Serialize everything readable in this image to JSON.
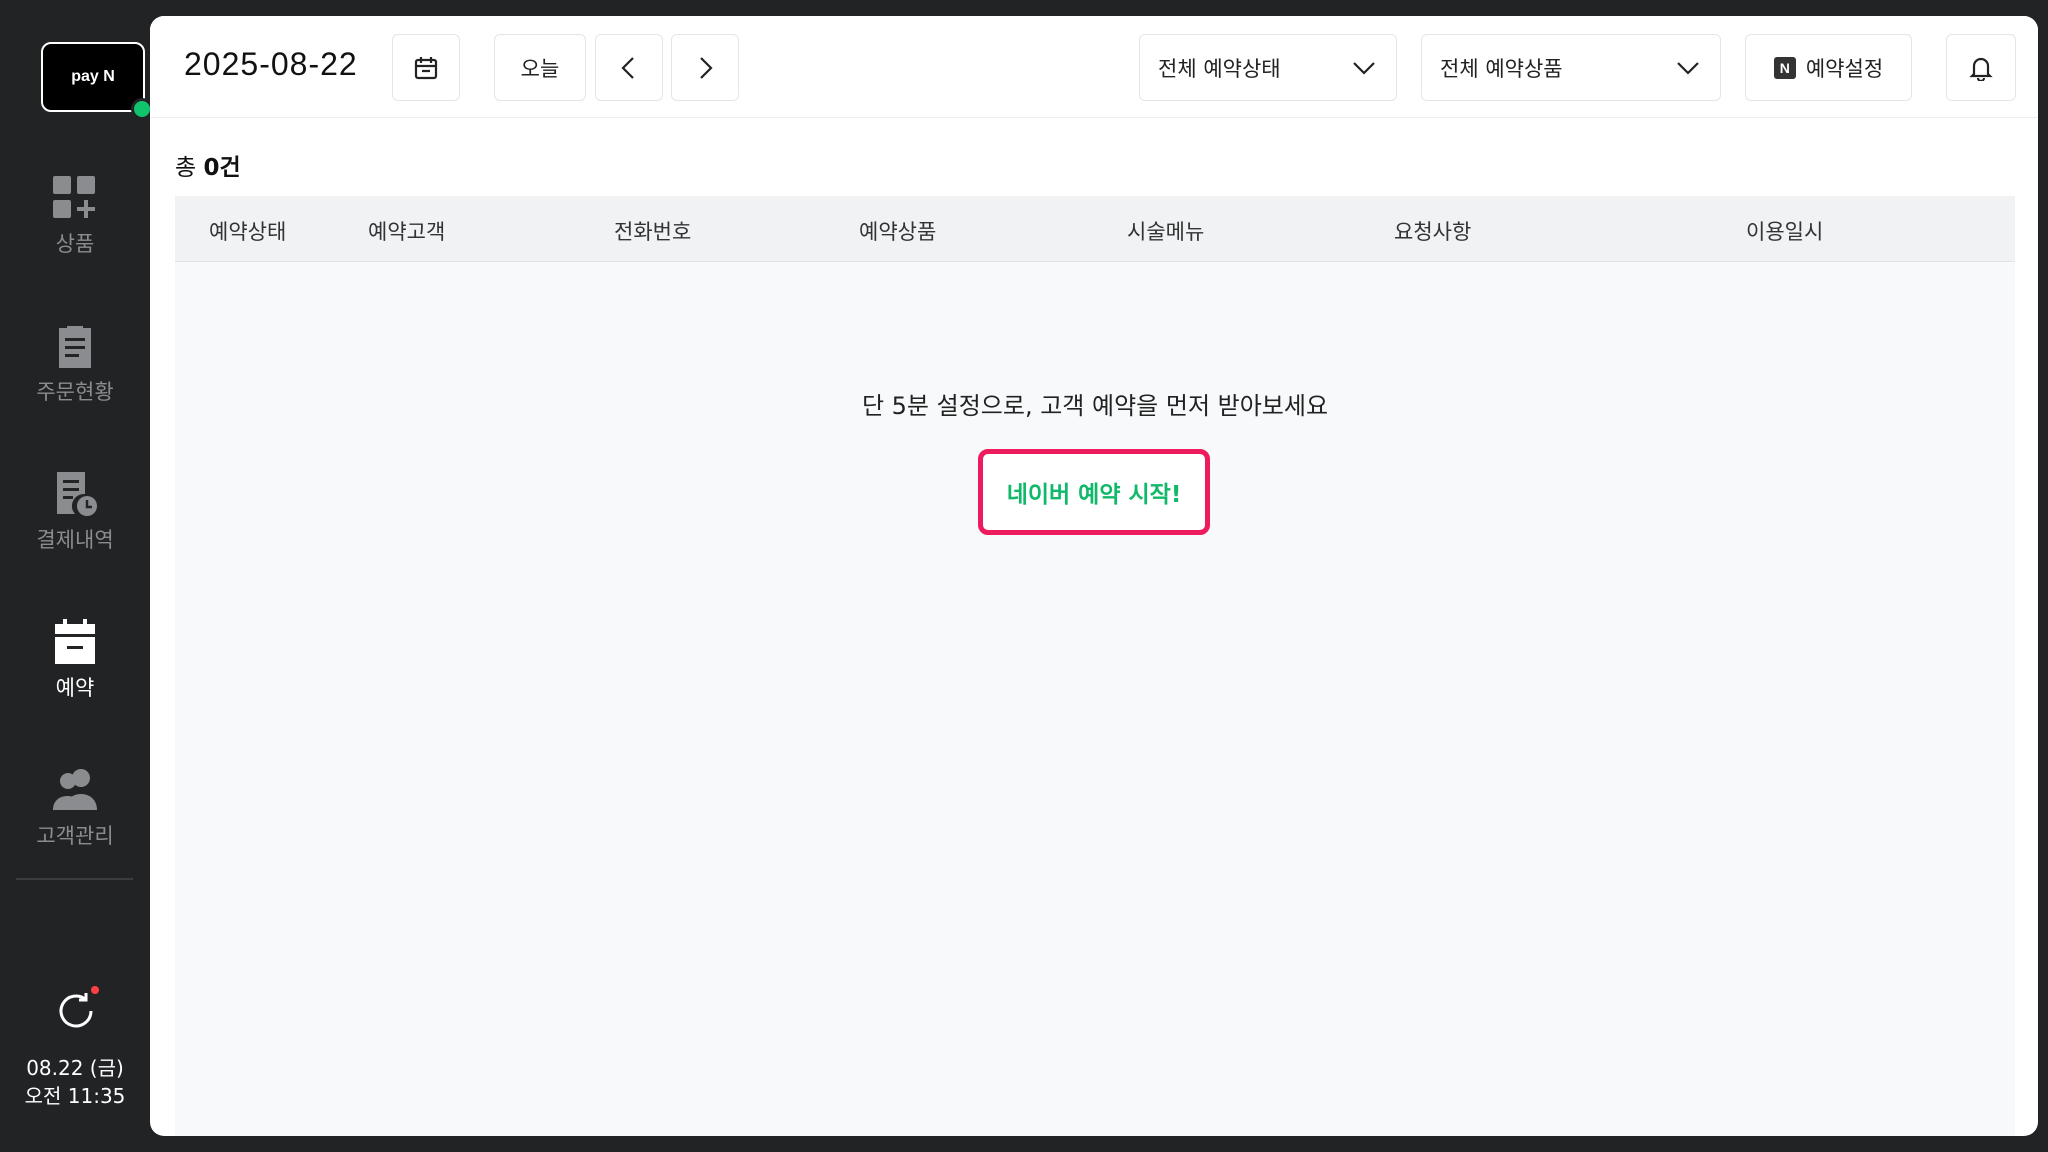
{
  "sidebar": {
    "logo_text": "pay N",
    "items": [
      {
        "label": "상품",
        "icon": "grid-add-icon",
        "active": false
      },
      {
        "label": "주문현황",
        "icon": "clipboard-icon",
        "active": false
      },
      {
        "label": "결제내역",
        "icon": "receipt-clock-icon",
        "active": false
      },
      {
        "label": "예약",
        "icon": "calendar-icon",
        "active": true
      },
      {
        "label": "고객관리",
        "icon": "users-icon",
        "active": false
      }
    ],
    "date": "08.22 (금)",
    "time": "오전 11:35"
  },
  "header": {
    "date": "2025-08-22",
    "today_label": "오늘",
    "status_filter": "전체 예약상태",
    "product_filter": "전체 예약상품",
    "settings_label": "예약설정",
    "settings_icon_letter": "N"
  },
  "summary": {
    "prefix": "총",
    "count": "0건"
  },
  "table": {
    "columns": [
      "예약상태",
      "예약고객",
      "전화번호",
      "예약상품",
      "시술메뉴",
      "요청사항",
      "이용일시"
    ]
  },
  "empty": {
    "message": "단 5분 설정으로, 고객 예약을 먼저 받아보세요",
    "cta_label": "네이버 예약 시작!"
  },
  "colors": {
    "accent_green": "#16c07a",
    "highlight_red": "#ec1c5e",
    "sidebar_bg": "#222324"
  }
}
